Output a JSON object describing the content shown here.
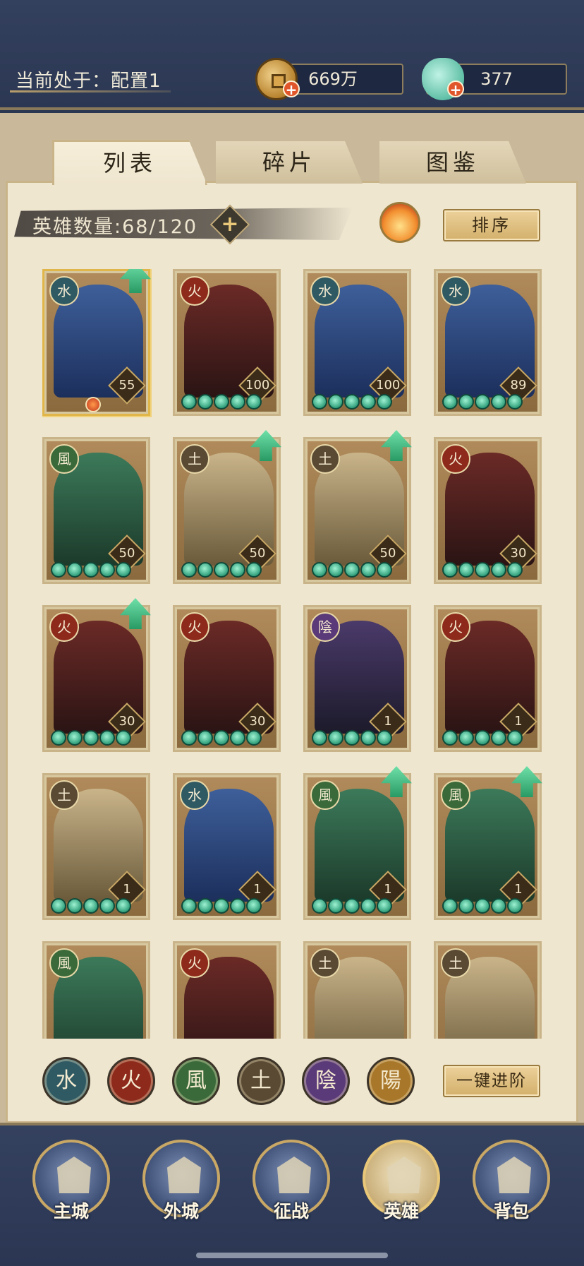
{
  "header": {
    "config_label": "当前处于：配置1",
    "coins": "669万",
    "jade": "377",
    "coin_icon": "copper-coin-icon",
    "jade_icon": "jade-icon",
    "plus": "+"
  },
  "tabs": [
    {
      "label": "列表",
      "active": true
    },
    {
      "label": "碎片",
      "active": false
    },
    {
      "label": "图鉴",
      "active": false
    }
  ],
  "hero_count": {
    "label": "英雄数量:68/120",
    "plus": "+"
  },
  "sort_button": "排序",
  "advance_button": "一键进阶",
  "elements": {
    "water": {
      "glyph": "水",
      "color": "#2f5a64"
    },
    "fire": {
      "glyph": "火",
      "color": "#8e2a1c"
    },
    "wind": {
      "glyph": "風",
      "color": "#3a6a3a"
    },
    "earth": {
      "glyph": "土",
      "color": "#5a4a34"
    },
    "yin": {
      "glyph": "陰",
      "color": "#5a3a78"
    },
    "yang": {
      "glyph": "陽",
      "color": "#a8772a"
    }
  },
  "heroes": [
    {
      "element": "water",
      "level": "55",
      "stars": 0,
      "upgrade": true,
      "selected": true
    },
    {
      "element": "fire",
      "level": "100",
      "stars": 5,
      "upgrade": false
    },
    {
      "element": "water",
      "level": "100",
      "stars": 5,
      "upgrade": false
    },
    {
      "element": "water",
      "level": "89",
      "stars": 5,
      "upgrade": false
    },
    {
      "element": "wind",
      "level": "50",
      "stars": 5,
      "upgrade": false
    },
    {
      "element": "earth",
      "level": "50",
      "stars": 5,
      "upgrade": true
    },
    {
      "element": "earth",
      "level": "50",
      "stars": 5,
      "upgrade": true
    },
    {
      "element": "fire",
      "level": "30",
      "stars": 5,
      "upgrade": false
    },
    {
      "element": "fire",
      "level": "30",
      "stars": 5,
      "upgrade": true
    },
    {
      "element": "fire",
      "level": "30",
      "stars": 5,
      "upgrade": false
    },
    {
      "element": "yin",
      "level": "1",
      "stars": 5,
      "upgrade": false
    },
    {
      "element": "fire",
      "level": "1",
      "stars": 5,
      "upgrade": false
    },
    {
      "element": "earth",
      "level": "1",
      "stars": 5,
      "upgrade": false
    },
    {
      "element": "water",
      "level": "1",
      "stars": 5,
      "upgrade": false
    },
    {
      "element": "wind",
      "level": "1",
      "stars": 5,
      "upgrade": true
    },
    {
      "element": "wind",
      "level": "1",
      "stars": 5,
      "upgrade": true
    },
    {
      "element": "wind",
      "level": "",
      "stars": 0,
      "upgrade": false
    },
    {
      "element": "fire",
      "level": "",
      "stars": 0,
      "upgrade": false
    },
    {
      "element": "earth",
      "level": "",
      "stars": 0,
      "upgrade": false
    },
    {
      "element": "earth",
      "level": "",
      "stars": 0,
      "upgrade": false
    }
  ],
  "filters": [
    "water",
    "fire",
    "wind",
    "earth",
    "yin",
    "yang"
  ],
  "nav": [
    {
      "label": "主城",
      "icon": "main-city-icon",
      "active": false
    },
    {
      "label": "外城",
      "icon": "outer-city-icon",
      "active": false
    },
    {
      "label": "征战",
      "icon": "campaign-icon",
      "active": false
    },
    {
      "label": "英雄",
      "icon": "hero-icon",
      "active": true
    },
    {
      "label": "背包",
      "icon": "backpack-icon",
      "active": false
    }
  ]
}
